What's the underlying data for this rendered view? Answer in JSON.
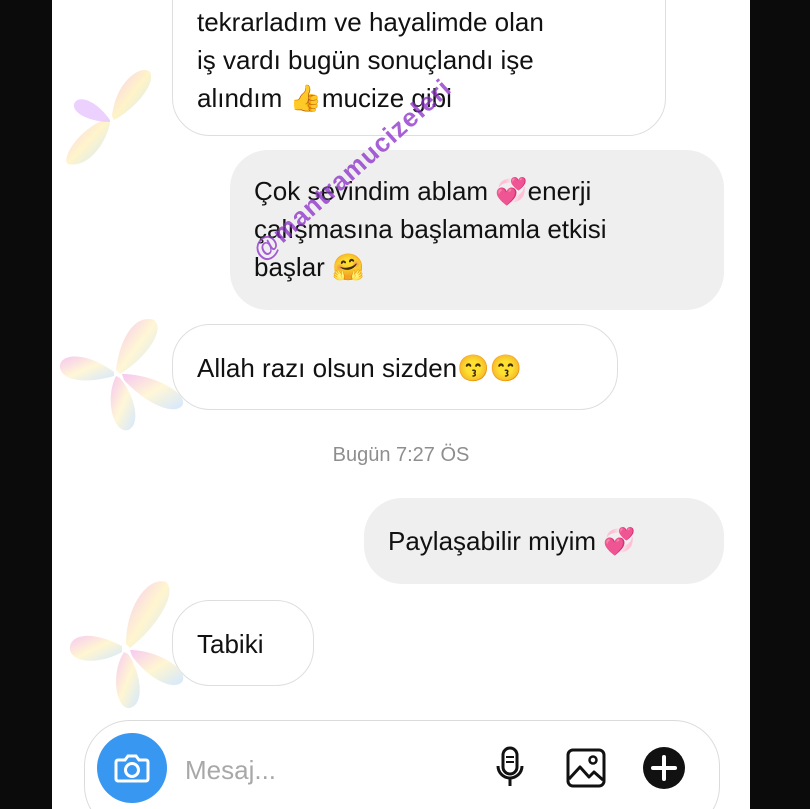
{
  "messages": [
    {
      "side": "incoming",
      "lines": [
        "tekrarladım ve hayalimde olan",
        "iş vardı bugün sonuçlandı  işe",
        "alındım 👍mucize gibi"
      ]
    },
    {
      "side": "outgoing",
      "lines": [
        "Çok sevindim ablam 💞enerji",
        "çalışmasına başlamamla etkisi",
        "başlar 🤗"
      ]
    },
    {
      "side": "incoming",
      "lines": [
        "Allah razı olsun sizden😙😙"
      ]
    },
    {
      "side": "outgoing",
      "lines": [
        "Paylaşabilir miyim 💞"
      ]
    },
    {
      "side": "incoming",
      "lines": [
        "Tabiki"
      ]
    }
  ],
  "timestamp": "Bugün 7:27 ÖS",
  "watermark": "@mantramucizeleri",
  "composer": {
    "placeholder": "Mesaj...",
    "icons": [
      "camera-icon",
      "microphone-icon",
      "gallery-icon",
      "plus-icon"
    ],
    "camera_color": "#3897f0"
  }
}
